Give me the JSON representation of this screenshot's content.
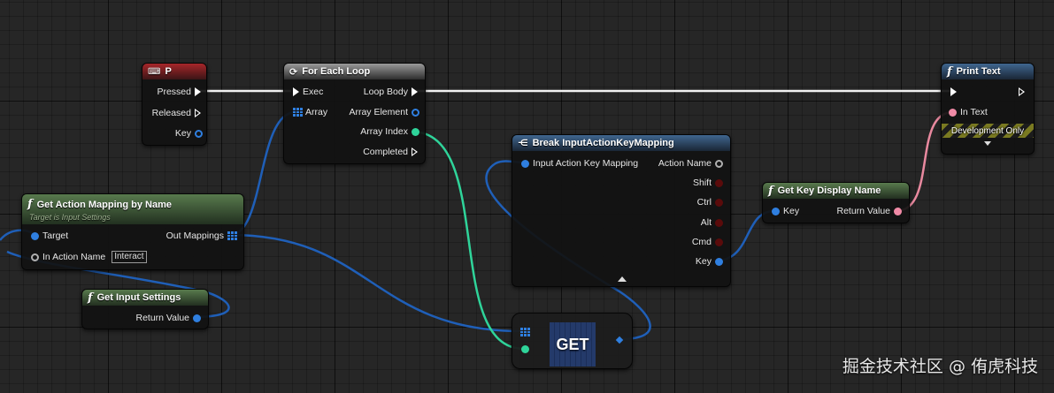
{
  "nodes": {
    "p_event": {
      "title": "P",
      "pins": {
        "pressed": "Pressed",
        "released": "Released",
        "key": "Key"
      }
    },
    "for_each": {
      "title": "For Each Loop",
      "pins": {
        "exec": "Exec",
        "array": "Array",
        "loop_body": "Loop Body",
        "array_element": "Array Element",
        "array_index": "Array Index",
        "completed": "Completed"
      }
    },
    "print_text": {
      "title": "Print Text",
      "pins": {
        "in_text": "In Text"
      },
      "dev_only": "Development Only"
    },
    "get_action_mapping": {
      "title": "Get Action Mapping by Name",
      "subtitle": "Target is Input Settings",
      "pins": {
        "target": "Target",
        "out_mappings": "Out Mappings",
        "in_action_name": "In Action Name"
      },
      "in_action_name_value": "Interact"
    },
    "break_mapping": {
      "title": "Break InputActionKeyMapping",
      "pins": {
        "input": "Input Action Key Mapping",
        "action_name": "Action Name",
        "shift": "Shift",
        "ctrl": "Ctrl",
        "alt": "Alt",
        "cmd": "Cmd",
        "key": "Key"
      }
    },
    "get_key_display": {
      "title": "Get Key Display Name",
      "pins": {
        "key": "Key",
        "return_value": "Return Value"
      }
    },
    "get_input_settings": {
      "title": "Get Input Settings",
      "pins": {
        "return_value": "Return Value"
      }
    },
    "get_node": {
      "label": "GET"
    }
  },
  "watermark": "掘金技术社区 @ 侑虎科技",
  "colors": {
    "exec": "#ffffff",
    "object": "#2f7fe0",
    "integer": "#2fd49a",
    "text": "#f08aa6",
    "name": "#b0b0b0"
  },
  "icons": {
    "event": "key-event-icon",
    "loop": "loop-icon",
    "function": "function-icon",
    "break": "break-struct-icon",
    "expand": "expand-arrow-icon",
    "collapse": "collapse-arrow-icon"
  }
}
